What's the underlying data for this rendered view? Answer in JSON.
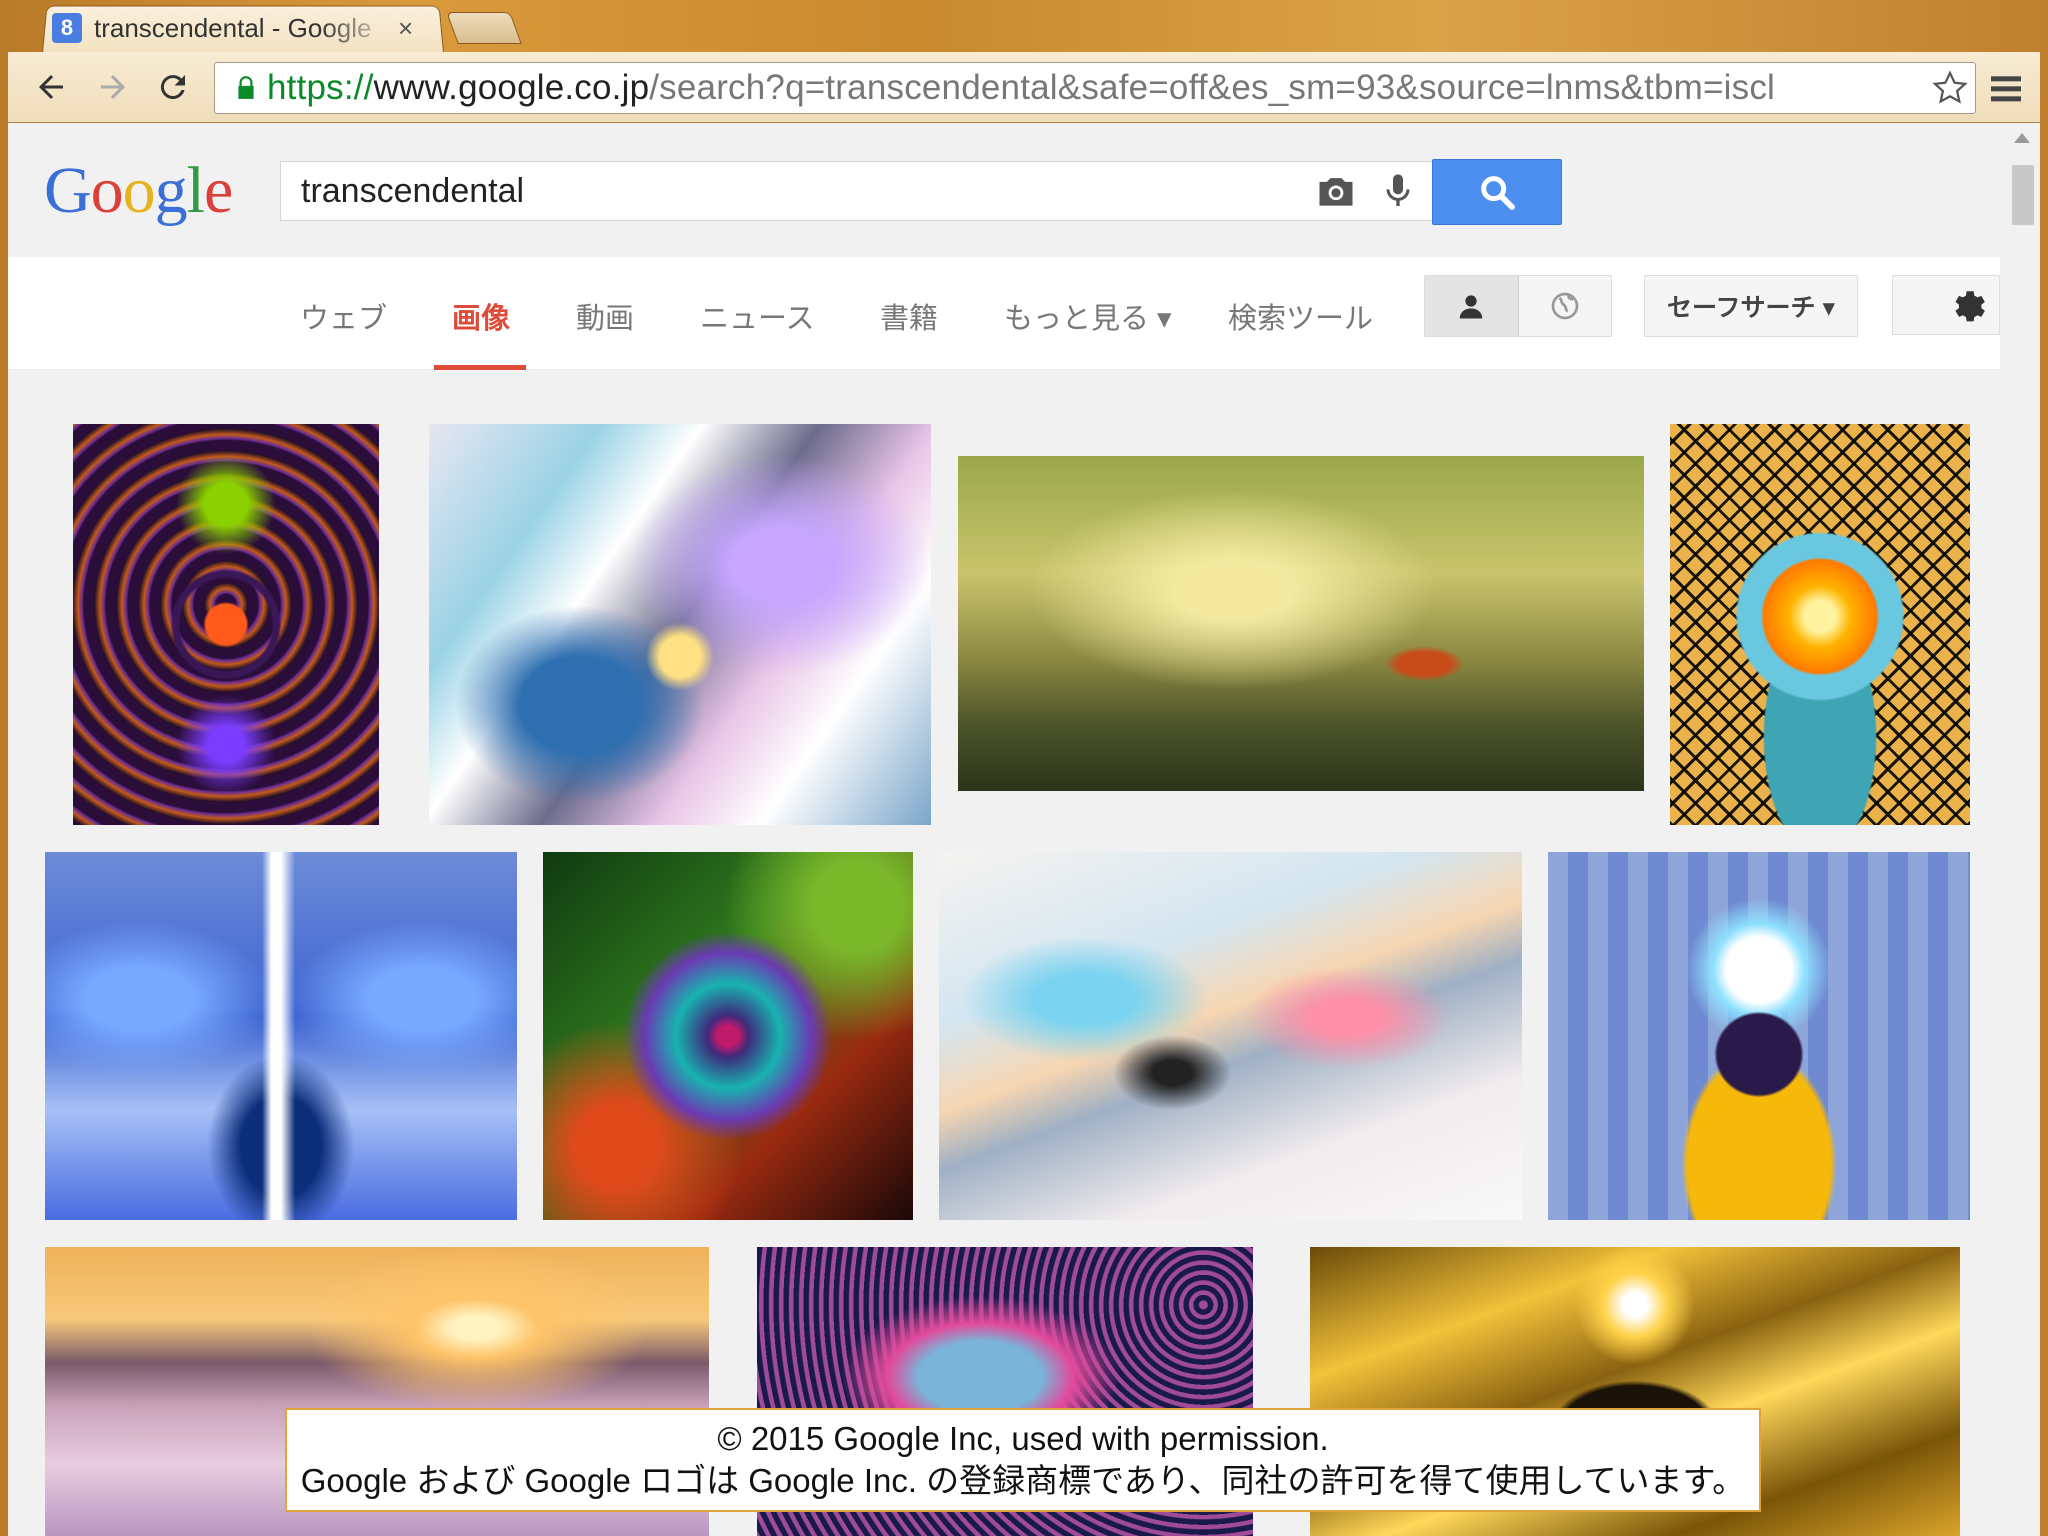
{
  "browser": {
    "tab_title": "transcendental - Google",
    "tab_close": "×",
    "favicon_letter": "8",
    "url_scheme": "https://",
    "url_host": "www.google.co.jp",
    "url_path": "/search?q=transcendental&safe=off&es_sm=93&source=lnms&tbm=iscl"
  },
  "google": {
    "logo_letters": [
      "G",
      "o",
      "o",
      "g",
      "l",
      "e"
    ],
    "logo_colors": [
      "#3b6fd8",
      "#d9413a",
      "#e6b31e",
      "#3b6fd8",
      "#2f9c45",
      "#d9413a"
    ],
    "query": "transcendental",
    "nav_tabs": [
      "ウェブ",
      "画像",
      "動画",
      "ニュース",
      "書籍",
      "もっと見る ▾",
      "検索ツール"
    ],
    "active_tab": "画像",
    "safe_search": "セーフサーチ ▾",
    "accent_color": "#dd4b39",
    "search_button_color": "#4d8ff0"
  },
  "notice": {
    "line1": "© 2015 Google Inc, used with permission.",
    "line2": "Google および Google ロゴは Google Inc. の登録商標であり、同社の許可を得て使用しています。"
  },
  "icons": [
    "back-icon",
    "forward-icon",
    "reload-icon",
    "lock-icon",
    "star-icon",
    "menu-icon",
    "camera-icon",
    "microphone-icon",
    "search-icon",
    "person-icon",
    "globe-icon",
    "gear-icon"
  ]
}
